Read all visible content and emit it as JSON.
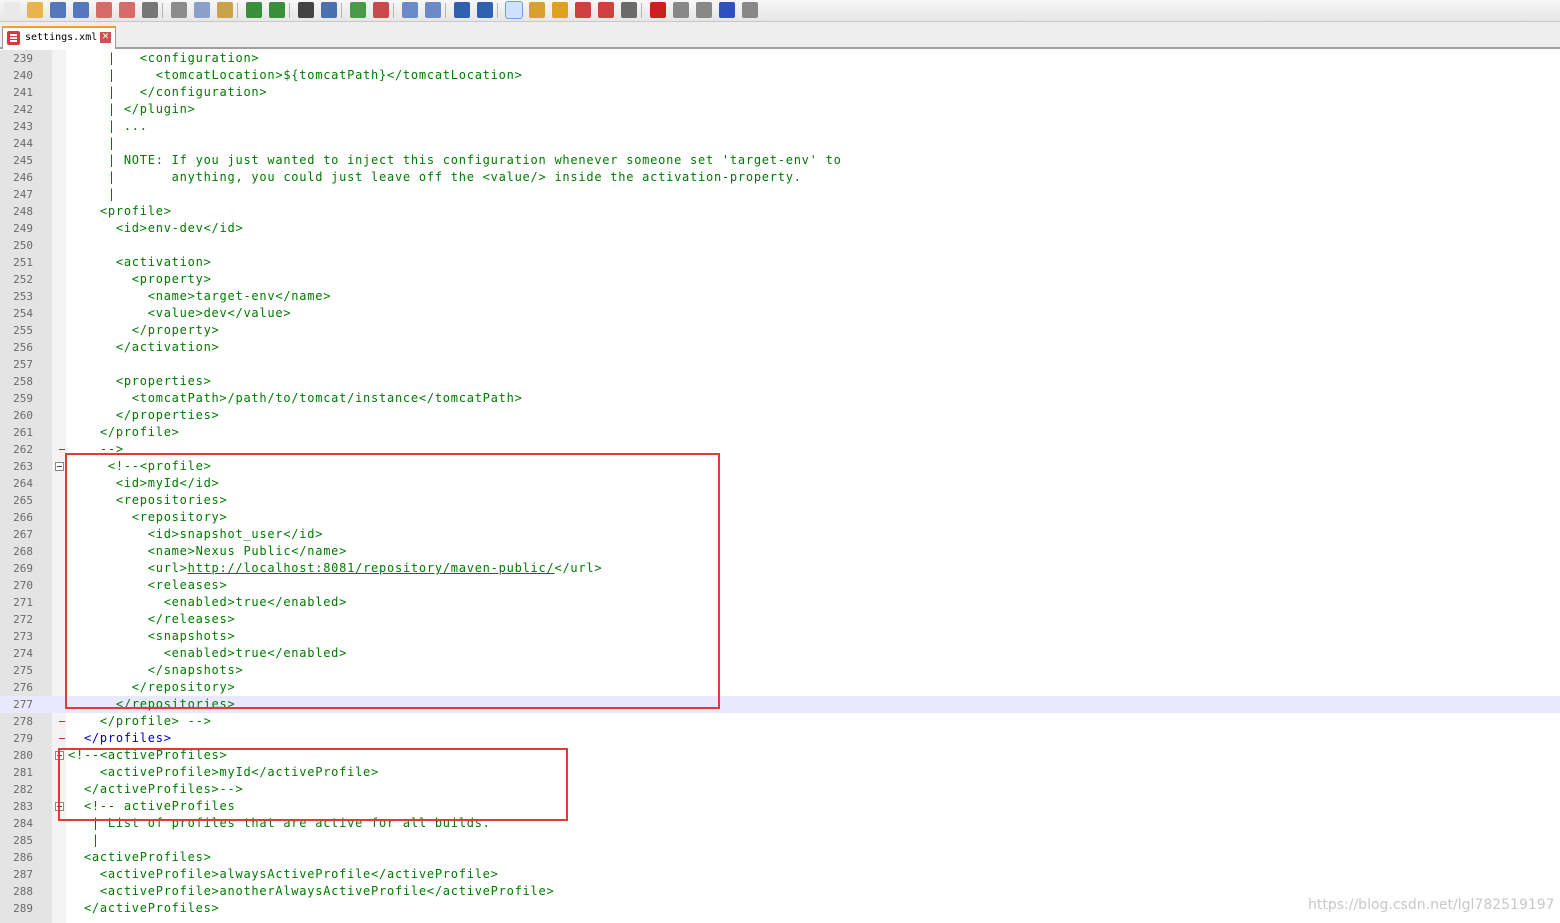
{
  "toolbar": {
    "buttons": [
      {
        "name": "new-file-icon",
        "color": "#e9e9e9",
        "active": false
      },
      {
        "name": "open-file-icon",
        "color": "#e8b54b",
        "active": false
      },
      {
        "name": "save-icon",
        "color": "#5577bb",
        "active": false
      },
      {
        "name": "save-all-icon",
        "color": "#5577bb",
        "active": false
      },
      {
        "name": "close-file-icon",
        "color": "#d86a6a",
        "active": false
      },
      {
        "name": "close-all-icon",
        "color": "#d86a6a",
        "active": false
      },
      {
        "name": "print-icon",
        "color": "#777777",
        "active": false
      },
      {
        "name": "cut-icon",
        "color": "#8c8c8c",
        "active": false
      },
      {
        "name": "copy-icon",
        "color": "#8aa0c8",
        "active": false
      },
      {
        "name": "paste-icon",
        "color": "#c9a24a",
        "active": false
      },
      {
        "name": "undo-icon",
        "color": "#3a8f3a",
        "active": false
      },
      {
        "name": "redo-icon",
        "color": "#3a8f3a",
        "active": false
      },
      {
        "name": "find-icon",
        "color": "#444444",
        "active": false
      },
      {
        "name": "replace-icon",
        "color": "#4a70b0",
        "active": false
      },
      {
        "name": "zoom-in-icon",
        "color": "#4a9a4a",
        "active": false
      },
      {
        "name": "zoom-out-icon",
        "color": "#c84a4a",
        "active": false
      },
      {
        "name": "sync-vertical-icon",
        "color": "#6a8ac8",
        "active": false
      },
      {
        "name": "sync-horizontal-icon",
        "color": "#6a8ac8",
        "active": false
      },
      {
        "name": "word-wrap-icon",
        "color": "#3060b0",
        "active": false
      },
      {
        "name": "show-all-chars-icon",
        "color": "#3060b0",
        "active": false
      },
      {
        "name": "indent-guide-icon",
        "color": "#3060b0",
        "active": true
      },
      {
        "name": "user-language-icon",
        "color": "#d8a030",
        "active": false
      },
      {
        "name": "document-map-icon",
        "color": "#e0a020",
        "active": false
      },
      {
        "name": "function-list-icon",
        "color": "#d04040",
        "active": false
      },
      {
        "name": "folder-workspace-icon",
        "color": "#d04040",
        "active": false
      },
      {
        "name": "monitoring-icon",
        "color": "#6a6a6a",
        "active": false
      },
      {
        "name": "record-macro-icon",
        "color": "#cc2020",
        "active": false
      },
      {
        "name": "stop-record-icon",
        "color": "#888888",
        "active": false
      },
      {
        "name": "play-macro-icon",
        "color": "#888888",
        "active": false
      },
      {
        "name": "play-macro-multiple-icon",
        "color": "#3050c0",
        "active": false
      },
      {
        "name": "save-macro-icon",
        "color": "#888888",
        "active": false
      }
    ]
  },
  "tabs": [
    {
      "label": "settings.xml",
      "close_glyph": "✕"
    }
  ],
  "colors": {
    "comment": "#007a00",
    "tag": "#0000cc",
    "highlight_box": "#e53935",
    "current_line": "#e8e8ff",
    "gutter": "#e4e4e4"
  },
  "editor": {
    "lines": [
      {
        "no": "239",
        "text": "     |   <configuration>",
        "cls": "comment"
      },
      {
        "no": "240",
        "text": "     |     <tomcatLocation>${tomcatPath}</tomcatLocation>",
        "cls": "comment"
      },
      {
        "no": "241",
        "text": "     |   </configuration>",
        "cls": "comment"
      },
      {
        "no": "242",
        "text": "     | </plugin>",
        "cls": "comment"
      },
      {
        "no": "243",
        "text": "     | ...",
        "cls": "comment"
      },
      {
        "no": "244",
        "text": "     |",
        "cls": "comment"
      },
      {
        "no": "245",
        "text": "     | NOTE: If you just wanted to inject this configuration whenever someone set 'target-env' to",
        "cls": "comment"
      },
      {
        "no": "246",
        "text": "     |       anything, you could just leave off the <value/> inside the activation-property.",
        "cls": "comment"
      },
      {
        "no": "247",
        "text": "     |",
        "cls": "comment"
      },
      {
        "no": "248",
        "text": "    <profile>",
        "cls": "comment"
      },
      {
        "no": "249",
        "text": "      <id>env-dev</id>",
        "cls": "comment"
      },
      {
        "no": "250",
        "text": "",
        "cls": "comment"
      },
      {
        "no": "251",
        "text": "      <activation>",
        "cls": "comment"
      },
      {
        "no": "252",
        "text": "        <property>",
        "cls": "comment"
      },
      {
        "no": "253",
        "text": "          <name>target-env</name>",
        "cls": "comment"
      },
      {
        "no": "254",
        "text": "          <value>dev</value>",
        "cls": "comment"
      },
      {
        "no": "255",
        "text": "        </property>",
        "cls": "comment"
      },
      {
        "no": "256",
        "text": "      </activation>",
        "cls": "comment"
      },
      {
        "no": "257",
        "text": "",
        "cls": "comment"
      },
      {
        "no": "258",
        "text": "      <properties>",
        "cls": "comment"
      },
      {
        "no": "259",
        "text": "        <tomcatPath>/path/to/tomcat/instance</tomcatPath>",
        "cls": "comment"
      },
      {
        "no": "260",
        "text": "      </properties>",
        "cls": "comment"
      },
      {
        "no": "261",
        "text": "    </profile>",
        "cls": "comment"
      },
      {
        "no": "262",
        "text": "    -->",
        "cls": "comment"
      },
      {
        "no": "263",
        "text": "     <!--<profile>",
        "cls": "comment"
      },
      {
        "no": "264",
        "text": "      <id>myId</id>",
        "cls": "comment"
      },
      {
        "no": "265",
        "text": "      <repositories>",
        "cls": "comment"
      },
      {
        "no": "266",
        "text": "        <repository>",
        "cls": "comment"
      },
      {
        "no": "267",
        "text": "          <id>snapshot_user</id>",
        "cls": "comment"
      },
      {
        "no": "268",
        "text": "          <name>Nexus Public</name>",
        "cls": "comment"
      },
      {
        "no": "269",
        "text": "          <url>",
        "link": "http://localhost:8081/repository/maven-public/",
        "after": "</url>",
        "cls": "comment"
      },
      {
        "no": "270",
        "text": "          <releases>",
        "cls": "comment"
      },
      {
        "no": "271",
        "text": "            <enabled>true</enabled>",
        "cls": "comment"
      },
      {
        "no": "272",
        "text": "          </releases>",
        "cls": "comment"
      },
      {
        "no": "273",
        "text": "          <snapshots>",
        "cls": "comment"
      },
      {
        "no": "274",
        "text": "            <enabled>true</enabled>",
        "cls": "comment"
      },
      {
        "no": "275",
        "text": "          </snapshots>",
        "cls": "comment"
      },
      {
        "no": "276",
        "text": "        </repository>",
        "cls": "comment"
      },
      {
        "no": "277",
        "text": "      </repositories>",
        "cls": "comment",
        "current": true
      },
      {
        "no": "278",
        "text": "    </profile> -->",
        "cls": "comment"
      },
      {
        "no": "279",
        "text": "  </profiles>",
        "cls": "tag"
      },
      {
        "no": "280",
        "text": "<!--<activeProfiles>",
        "cls": "comment"
      },
      {
        "no": "281",
        "text": "    <activeProfile>myId</activeProfile>",
        "cls": "comment"
      },
      {
        "no": "282",
        "text": "  </activeProfiles>-->",
        "cls": "comment"
      },
      {
        "no": "283",
        "text": "  <!-- activeProfiles",
        "cls": "comment"
      },
      {
        "no": "284",
        "text": "   | List of profiles that are active for all builds.",
        "cls": "comment"
      },
      {
        "no": "285",
        "text": "   |",
        "cls": "comment"
      },
      {
        "no": "286",
        "text": "  <activeProfiles>",
        "cls": "comment"
      },
      {
        "no": "287",
        "text": "    <activeProfile>alwaysActiveProfile</activeProfile>",
        "cls": "comment"
      },
      {
        "no": "288",
        "text": "    <activeProfile>anotherAlwaysActiveProfile</activeProfile>",
        "cls": "comment"
      },
      {
        "no": "289",
        "text": "  </activeProfiles>",
        "cls": "comment"
      }
    ]
  },
  "watermark": "https://blog.csdn.net/lgl782519197"
}
